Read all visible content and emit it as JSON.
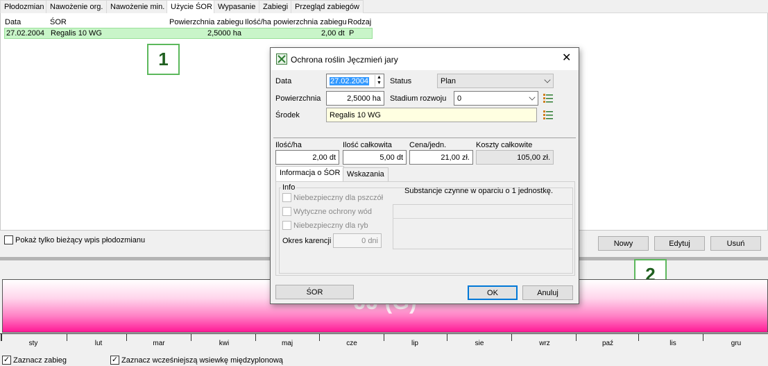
{
  "tabs": [
    "Płodozmian",
    "Nawożenie org.",
    "Nawożenie min.",
    "Użycie ŚOR",
    "Wypasanie",
    "Zabiegi",
    "Przegląd zabiegów"
  ],
  "active_tab": "Użycie ŚOR",
  "table": {
    "headers": [
      "Data",
      "ŚOR",
      "Powierzchnia zabiegu",
      "Ilość/ha",
      "powierzchnia zabiegu",
      "Rodzaj"
    ],
    "row": [
      "27.02.2004",
      "Regalis 10 WG",
      "2,5000 ha",
      "2,00 dt",
      "P"
    ]
  },
  "annotations": [
    "1",
    "2"
  ],
  "show_current_only": "Pokaż tylko bieżący wpis płodozmianu",
  "buttons": {
    "new": "Nowy",
    "edit": "Edytuj",
    "delete": "Usuń"
  },
  "timeline": {
    "label": "JJ (G)",
    "months": [
      "sty",
      "lut",
      "mar",
      "kwi",
      "maj",
      "cze",
      "lip",
      "sie",
      "wrz",
      "paź",
      "lis",
      "gru"
    ]
  },
  "footer": {
    "mark_treatment": "Zaznacz zabieg",
    "mark_earlier": "Zaznacz wcześniejszą wsiewkę międzyplonową"
  },
  "dialog": {
    "title": "Ochrona roślin  Jęczmień jary",
    "labels": {
      "date": "Data",
      "status": "Status",
      "area": "Powierzchnia",
      "stage": "Stadium rozwoju",
      "agent": "Środek",
      "qty_ha": "Ilość/ha",
      "qty_total": "Ilość całkowita",
      "price": "Cena/jedn.",
      "cost_total": "Koszty całkowite"
    },
    "values": {
      "date": "27.02.2004",
      "status": "Plan",
      "area": "2,5000 ha",
      "stage": "0",
      "agent": "Regalis 10 WG",
      "qty_ha": "2,00 dt",
      "qty_total": "5,00 dt",
      "price": "21,00 zł.",
      "cost_total": "105,00 zł."
    },
    "tabs": [
      "Informacja o ŚOR",
      "Wskazania"
    ],
    "info": {
      "group": "Info",
      "bees": "Niebezpieczny dla pszczół",
      "water": "Wytyczne ochrony wód",
      "fish": "Niebezpieczny dla ryb",
      "waiting_label": "Okres karencji",
      "waiting_value": "0 dni",
      "substances": "Substancje czynne w oparciu o 1 jednostkę."
    },
    "buttons": {
      "sor": "ŚOR",
      "ok": "OK",
      "cancel": "Anuluj"
    }
  },
  "colors": {
    "selected_row": "#c9f5c9",
    "badge_border": "#5cb85c",
    "timeline": "#ff1a96"
  }
}
